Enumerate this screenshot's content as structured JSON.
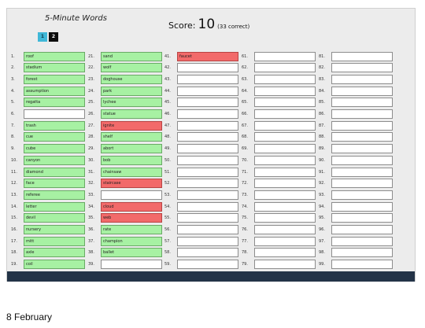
{
  "app": {
    "title": "5-Minute Words",
    "score_label": "Score:",
    "score_value": "10",
    "correct_text": "(33 correct)"
  },
  "pagination": {
    "page1": "1",
    "page2": "2",
    "active_color": "#40b8d8",
    "inactive_color": "#0d0d0d"
  },
  "colors": {
    "correct": "#a7f1a3",
    "wrong": "#f26a6a",
    "empty": "#ffffff",
    "bottom_bar": "#233347"
  },
  "columns": [
    {
      "start": 1,
      "cells": [
        {
          "text": "roof",
          "status": "correct"
        },
        {
          "text": "stadium",
          "status": "correct"
        },
        {
          "text": "forest",
          "status": "correct"
        },
        {
          "text": "assumption",
          "status": "correct"
        },
        {
          "text": "regatta",
          "status": "correct"
        },
        {
          "text": "",
          "status": "empty"
        },
        {
          "text": "trash",
          "status": "correct"
        },
        {
          "text": "cue",
          "status": "correct"
        },
        {
          "text": "cube",
          "status": "correct"
        },
        {
          "text": "canyon",
          "status": "correct"
        },
        {
          "text": "diamond",
          "status": "correct"
        },
        {
          "text": "face",
          "status": "correct"
        },
        {
          "text": "referee",
          "status": "correct"
        },
        {
          "text": "letter",
          "status": "correct"
        },
        {
          "text": "devil",
          "status": "correct"
        },
        {
          "text": "nursery",
          "status": "correct"
        },
        {
          "text": "mitt",
          "status": "correct"
        },
        {
          "text": "axle",
          "status": "correct"
        },
        {
          "text": "coil",
          "status": "correct"
        }
      ]
    },
    {
      "start": 21,
      "cells": [
        {
          "text": "sand",
          "status": "correct"
        },
        {
          "text": "wolf",
          "status": "correct"
        },
        {
          "text": "doghouse",
          "status": "correct"
        },
        {
          "text": "park",
          "status": "correct"
        },
        {
          "text": "lychee",
          "status": "correct"
        },
        {
          "text": "statue",
          "status": "correct"
        },
        {
          "text": "ignite",
          "status": "wrong"
        },
        {
          "text": "shelf",
          "status": "correct"
        },
        {
          "text": "abort",
          "status": "correct"
        },
        {
          "text": "bob",
          "status": "correct"
        },
        {
          "text": "chainsaw",
          "status": "correct"
        },
        {
          "text": "staircase",
          "status": "wrong"
        },
        {
          "text": "",
          "status": "empty"
        },
        {
          "text": "cloud",
          "status": "wrong"
        },
        {
          "text": "web",
          "status": "wrong"
        },
        {
          "text": "rate",
          "status": "correct"
        },
        {
          "text": "champion",
          "status": "correct"
        },
        {
          "text": "ballet",
          "status": "correct"
        },
        {
          "text": "",
          "status": "empty"
        }
      ]
    },
    {
      "start": 41,
      "cells": [
        {
          "text": "faucet",
          "status": "wrong"
        },
        {
          "text": "",
          "status": "empty"
        },
        {
          "text": "",
          "status": "empty"
        },
        {
          "text": "",
          "status": "empty"
        },
        {
          "text": "",
          "status": "empty"
        },
        {
          "text": "",
          "status": "empty"
        },
        {
          "text": "",
          "status": "empty"
        },
        {
          "text": "",
          "status": "empty"
        },
        {
          "text": "",
          "status": "empty"
        },
        {
          "text": "",
          "status": "empty"
        },
        {
          "text": "",
          "status": "empty"
        },
        {
          "text": "",
          "status": "empty"
        },
        {
          "text": "",
          "status": "empty"
        },
        {
          "text": "",
          "status": "empty"
        },
        {
          "text": "",
          "status": "empty"
        },
        {
          "text": "",
          "status": "empty"
        },
        {
          "text": "",
          "status": "empty"
        },
        {
          "text": "",
          "status": "empty"
        },
        {
          "text": "",
          "status": "empty"
        }
      ]
    },
    {
      "start": 61,
      "cells": [
        {
          "text": "",
          "status": "empty"
        },
        {
          "text": "",
          "status": "empty"
        },
        {
          "text": "",
          "status": "empty"
        },
        {
          "text": "",
          "status": "empty"
        },
        {
          "text": "",
          "status": "empty"
        },
        {
          "text": "",
          "status": "empty"
        },
        {
          "text": "",
          "status": "empty"
        },
        {
          "text": "",
          "status": "empty"
        },
        {
          "text": "",
          "status": "empty"
        },
        {
          "text": "",
          "status": "empty"
        },
        {
          "text": "",
          "status": "empty"
        },
        {
          "text": "",
          "status": "empty"
        },
        {
          "text": "",
          "status": "empty"
        },
        {
          "text": "",
          "status": "empty"
        },
        {
          "text": "",
          "status": "empty"
        },
        {
          "text": "",
          "status": "empty"
        },
        {
          "text": "",
          "status": "empty"
        },
        {
          "text": "",
          "status": "empty"
        },
        {
          "text": "",
          "status": "empty"
        }
      ]
    },
    {
      "start": 81,
      "cells": [
        {
          "text": "",
          "status": "empty"
        },
        {
          "text": "",
          "status": "empty"
        },
        {
          "text": "",
          "status": "empty"
        },
        {
          "text": "",
          "status": "empty"
        },
        {
          "text": "",
          "status": "empty"
        },
        {
          "text": "",
          "status": "empty"
        },
        {
          "text": "",
          "status": "empty"
        },
        {
          "text": "",
          "status": "empty"
        },
        {
          "text": "",
          "status": "empty"
        },
        {
          "text": "",
          "status": "empty"
        },
        {
          "text": "",
          "status": "empty"
        },
        {
          "text": "",
          "status": "empty"
        },
        {
          "text": "",
          "status": "empty"
        },
        {
          "text": "",
          "status": "empty"
        },
        {
          "text": "",
          "status": "empty"
        },
        {
          "text": "",
          "status": "empty"
        },
        {
          "text": "",
          "status": "empty"
        },
        {
          "text": "",
          "status": "empty"
        },
        {
          "text": "",
          "status": "empty"
        }
      ]
    }
  ],
  "caption": "8 February"
}
